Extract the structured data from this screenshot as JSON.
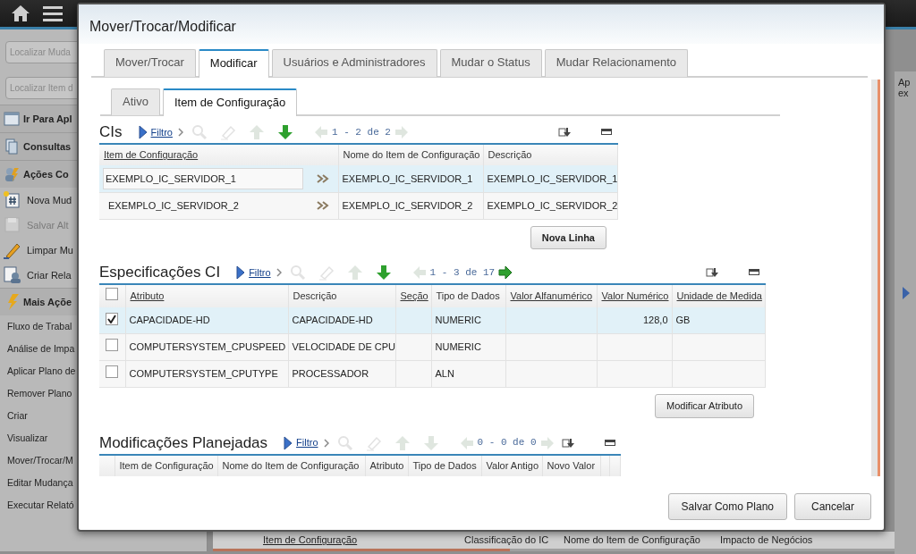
{
  "sidebar": {
    "search_fields": [
      {
        "placeholder": "Localizar Muda"
      },
      {
        "placeholder": "Localizar Item d"
      }
    ],
    "items": [
      {
        "kind": "header",
        "label": "Ir Para Apl"
      },
      {
        "kind": "header",
        "label": "Consultas"
      },
      {
        "kind": "header",
        "label": "Ações Co"
      },
      {
        "kind": "action",
        "label": "Nova Mud",
        "disabled": false
      },
      {
        "kind": "action",
        "label": "Salvar Alt",
        "disabled": true
      },
      {
        "kind": "action",
        "label": "Limpar Mu",
        "disabled": false
      },
      {
        "kind": "action",
        "label": "Criar Rela",
        "disabled": false
      },
      {
        "kind": "header",
        "label": "Mais Açõe"
      },
      {
        "kind": "link",
        "label": "Fluxo de Trabal"
      },
      {
        "kind": "link",
        "label": "Análise de Impa"
      },
      {
        "kind": "link",
        "label": "Aplicar Plano de"
      },
      {
        "kind": "link",
        "label": "Remover Plano"
      },
      {
        "kind": "link",
        "label": "Criar"
      },
      {
        "kind": "link",
        "label": "Visualizar"
      },
      {
        "kind": "link",
        "label": "Mover/Trocar/M"
      },
      {
        "kind": "link",
        "label": "Editar Mudança"
      },
      {
        "kind": "link",
        "label": "Executar Relató"
      }
    ]
  },
  "background_table": {
    "columns": [
      "Item de Configuração",
      "Classificação do IC",
      "Nome do Item de Configuração",
      "Impacto de Negócios"
    ]
  },
  "right_panel": {
    "text": [
      "Ap",
      "ex"
    ]
  },
  "dialog": {
    "title": "Mover/Trocar/Modificar",
    "tabs": [
      {
        "label": "Mover/Trocar",
        "selected": false
      },
      {
        "label": "Modificar",
        "selected": true
      },
      {
        "label": "Usuários e Administradores",
        "selected": false
      },
      {
        "label": "Mudar o Status",
        "selected": false
      },
      {
        "label": "Mudar Relacionamento",
        "selected": false
      }
    ],
    "subtabs": [
      {
        "label": "Ativo",
        "selected": false
      },
      {
        "label": "Item de Configuração",
        "selected": true
      }
    ],
    "sections": [
      {
        "kind": "cis",
        "title": "CIs",
        "filter": "Filtro",
        "tools": [
          {
            "kind": "search",
            "disabled": true
          },
          {
            "kind": "eraser",
            "disabled": true
          },
          {
            "kind": "up",
            "disabled": true
          },
          {
            "kind": "down",
            "disabled": false
          }
        ],
        "pager": {
          "text": "1 - 2 de 2",
          "prev_disabled": true,
          "next_disabled": true
        },
        "columns": [
          {
            "label": "Item de Configuração",
            "sortable": true
          },
          {
            "label": "Nome do Item de Configuração",
            "sortable": false
          },
          {
            "label": "Descrição",
            "sortable": false
          }
        ],
        "rows": [
          {
            "selected": true,
            "cells": [
              "EXEMPLO_IC_SERVIDOR_1",
              "EXEMPLO_IC_SERVIDOR_1",
              "EXEMPLO_IC_SERVIDOR_1"
            ]
          },
          {
            "selected": false,
            "cells": [
              "EXEMPLO_IC_SERVIDOR_2",
              "EXEMPLO_IC_SERVIDOR_2",
              "EXEMPLO_IC_SERVIDOR_2"
            ]
          }
        ],
        "button": "Nova Linha"
      },
      {
        "kind": "specs",
        "title": "Especificações CI",
        "filter": "Filtro",
        "tools": [
          {
            "kind": "search",
            "disabled": true
          },
          {
            "kind": "eraser",
            "disabled": true
          },
          {
            "kind": "up",
            "disabled": true
          },
          {
            "kind": "down",
            "disabled": false
          }
        ],
        "pager": {
          "text": "1 - 3 de 17",
          "prev_disabled": true,
          "next_disabled": false
        },
        "select_all": {
          "checked": false
        },
        "columns": [
          {
            "label": "Atributo",
            "sortable": true
          },
          {
            "label": "Descrição",
            "sortable": false
          },
          {
            "label": "Seção",
            "sortable": true
          },
          {
            "label": "Tipo de Dados",
            "sortable": false
          },
          {
            "label": "Valor Alfanumérico",
            "sortable": true
          },
          {
            "label": "Valor Numérico",
            "sortable": true
          },
          {
            "label": "Unidade de Medida",
            "sortable": true
          }
        ],
        "rows": [
          {
            "selected": true,
            "checked": true,
            "cells": [
              "CAPACIDADE-HD",
              "CAPACIDADE-HD",
              "",
              "NUMERIC",
              "",
              "128,0",
              "GB"
            ]
          },
          {
            "selected": false,
            "checked": false,
            "cells": [
              "COMPUTERSYSTEM_CPUSPEED",
              "VELOCIDADE DE CPU",
              "",
              "NUMERIC",
              "",
              "",
              ""
            ]
          },
          {
            "selected": false,
            "checked": false,
            "cells": [
              "COMPUTERSYSTEM_CPUTYPE",
              "PROCESSADOR",
              "",
              "ALN",
              "",
              "",
              ""
            ]
          }
        ],
        "button": "Modificar Atributo"
      },
      {
        "kind": "planned",
        "title": "Modificações Planejadas",
        "filter": "Filtro",
        "tools": [
          {
            "kind": "search",
            "disabled": true
          },
          {
            "kind": "eraser",
            "disabled": true
          },
          {
            "kind": "up",
            "disabled": true
          },
          {
            "kind": "down",
            "disabled": true
          }
        ],
        "pager": {
          "text": "0 - 0 de 0",
          "prev_disabled": true,
          "next_disabled": true
        },
        "columns": [
          {
            "label": "Item de Configuração",
            "sortable": false
          },
          {
            "label": "Nome do Item de Configuração",
            "sortable": false
          },
          {
            "label": "Atributo",
            "sortable": false
          },
          {
            "label": "Tipo de Dados",
            "sortable": false
          },
          {
            "label": "Valor Antigo",
            "sortable": false
          },
          {
            "label": "Novo Valor",
            "sortable": false
          }
        ]
      }
    ],
    "buttons": [
      "Salvar Como Plano",
      "Cancelar"
    ]
  }
}
